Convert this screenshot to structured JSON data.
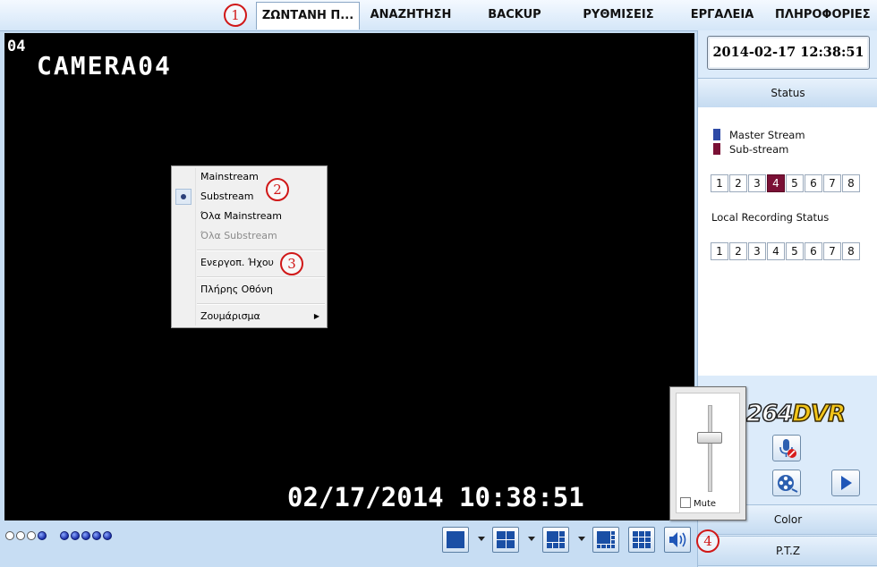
{
  "menu": {
    "tabs": [
      {
        "label": "ΖΩΝΤΑΝΗ Π...",
        "active": true
      },
      {
        "label": "ΑΝΑΖΗΤΗΣΗ"
      },
      {
        "label": "BACKUP"
      },
      {
        "label": "ΡΥΘΜΙΣΕΙΣ"
      },
      {
        "label": "ΕΡΓΑΛΕΙΑ"
      },
      {
        "label": "ΠΛΗΡΟΦΟΡΙΕΣ"
      }
    ]
  },
  "markers": [
    "1",
    "2",
    "3",
    "4"
  ],
  "video": {
    "channel_number": "04",
    "camera_name": "CAMERA04",
    "timestamp": "02/17/2014 10:38:51",
    "background": "#000000"
  },
  "context_menu": {
    "items": [
      {
        "label": "Mainstream"
      },
      {
        "label": "Substream",
        "selected": true
      },
      {
        "label": "Όλα Mainstream"
      },
      {
        "label": "Όλα Substream",
        "disabled": true
      },
      {
        "label": "Ενεργοπ. Ήχου"
      },
      {
        "label": "Πλήρης Οθόνη"
      },
      {
        "label": "Ζουμάρισμα",
        "submenu": true
      }
    ]
  },
  "right_panel": {
    "clock": "2014-02-17 12:38:51",
    "status_label": "Status",
    "legend": [
      {
        "label": "Master Stream",
        "color": "#2e4aa6"
      },
      {
        "label": "Sub-stream",
        "color": "#7a1035"
      }
    ],
    "stream_channels": [
      "1",
      "2",
      "3",
      "4",
      "5",
      "6",
      "7",
      "8"
    ],
    "stream_active_channel": "4",
    "local_recording_label": "Local Recording Status",
    "recording_channels": [
      "1",
      "2",
      "3",
      "4",
      "5",
      "6",
      "7",
      "8"
    ],
    "logo": {
      "part1": "264",
      "part2": "DVR"
    },
    "color_label": "Color",
    "ptz_label": "P.T.Z"
  },
  "volume_popup": {
    "mute_label": "Mute",
    "mute_checked": false,
    "level": 0.6
  },
  "status_dots": [
    "off",
    "off",
    "off",
    "on",
    "on",
    "on",
    "on",
    "on"
  ],
  "icons": [
    "mic-muted-icon",
    "film-reel-icon",
    "play-icon",
    "speaker-icon",
    "layout-1-icon",
    "layout-4-icon",
    "layout-6-icon",
    "layout-8-icon",
    "layout-9-icon"
  ]
}
